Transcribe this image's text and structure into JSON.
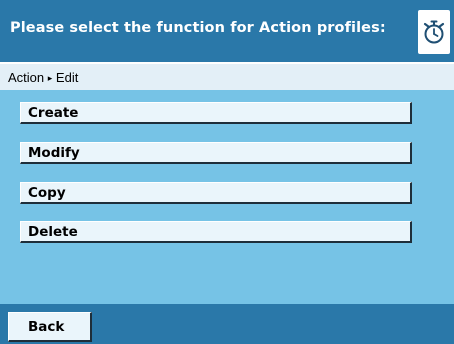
{
  "header": {
    "title": "Please select the function for Action profiles:",
    "icon": "stopwatch-icon"
  },
  "breadcrumb": {
    "parent": "Action",
    "separator": "▸",
    "current": "Edit"
  },
  "functions": [
    {
      "label": "Create"
    },
    {
      "label": "Modify"
    },
    {
      "label": "Copy"
    },
    {
      "label": "Delete"
    }
  ],
  "footer": {
    "back_label": "Back"
  },
  "colors": {
    "header_blue": "#2a78a9",
    "content_blue": "#76c3e6",
    "breadcrumb_bg": "#e3eff7",
    "button_face": "#eaf5fb"
  }
}
